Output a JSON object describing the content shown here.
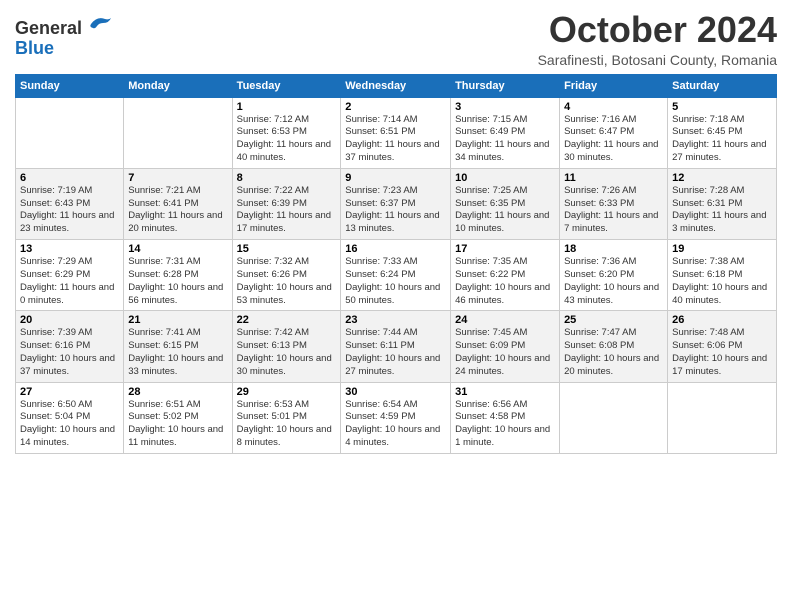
{
  "header": {
    "logo_general": "General",
    "logo_blue": "Blue",
    "main_title": "October 2024",
    "subtitle": "Sarafinesti, Botosani County, Romania"
  },
  "days_of_week": [
    "Sunday",
    "Monday",
    "Tuesday",
    "Wednesday",
    "Thursday",
    "Friday",
    "Saturday"
  ],
  "weeks": [
    [
      {
        "day": "",
        "info": ""
      },
      {
        "day": "",
        "info": ""
      },
      {
        "day": "1",
        "info": "Sunrise: 7:12 AM\nSunset: 6:53 PM\nDaylight: 11 hours and 40 minutes."
      },
      {
        "day": "2",
        "info": "Sunrise: 7:14 AM\nSunset: 6:51 PM\nDaylight: 11 hours and 37 minutes."
      },
      {
        "day": "3",
        "info": "Sunrise: 7:15 AM\nSunset: 6:49 PM\nDaylight: 11 hours and 34 minutes."
      },
      {
        "day": "4",
        "info": "Sunrise: 7:16 AM\nSunset: 6:47 PM\nDaylight: 11 hours and 30 minutes."
      },
      {
        "day": "5",
        "info": "Sunrise: 7:18 AM\nSunset: 6:45 PM\nDaylight: 11 hours and 27 minutes."
      }
    ],
    [
      {
        "day": "6",
        "info": "Sunrise: 7:19 AM\nSunset: 6:43 PM\nDaylight: 11 hours and 23 minutes."
      },
      {
        "day": "7",
        "info": "Sunrise: 7:21 AM\nSunset: 6:41 PM\nDaylight: 11 hours and 20 minutes."
      },
      {
        "day": "8",
        "info": "Sunrise: 7:22 AM\nSunset: 6:39 PM\nDaylight: 11 hours and 17 minutes."
      },
      {
        "day": "9",
        "info": "Sunrise: 7:23 AM\nSunset: 6:37 PM\nDaylight: 11 hours and 13 minutes."
      },
      {
        "day": "10",
        "info": "Sunrise: 7:25 AM\nSunset: 6:35 PM\nDaylight: 11 hours and 10 minutes."
      },
      {
        "day": "11",
        "info": "Sunrise: 7:26 AM\nSunset: 6:33 PM\nDaylight: 11 hours and 7 minutes."
      },
      {
        "day": "12",
        "info": "Sunrise: 7:28 AM\nSunset: 6:31 PM\nDaylight: 11 hours and 3 minutes."
      }
    ],
    [
      {
        "day": "13",
        "info": "Sunrise: 7:29 AM\nSunset: 6:29 PM\nDaylight: 11 hours and 0 minutes."
      },
      {
        "day": "14",
        "info": "Sunrise: 7:31 AM\nSunset: 6:28 PM\nDaylight: 10 hours and 56 minutes."
      },
      {
        "day": "15",
        "info": "Sunrise: 7:32 AM\nSunset: 6:26 PM\nDaylight: 10 hours and 53 minutes."
      },
      {
        "day": "16",
        "info": "Sunrise: 7:33 AM\nSunset: 6:24 PM\nDaylight: 10 hours and 50 minutes."
      },
      {
        "day": "17",
        "info": "Sunrise: 7:35 AM\nSunset: 6:22 PM\nDaylight: 10 hours and 46 minutes."
      },
      {
        "day": "18",
        "info": "Sunrise: 7:36 AM\nSunset: 6:20 PM\nDaylight: 10 hours and 43 minutes."
      },
      {
        "day": "19",
        "info": "Sunrise: 7:38 AM\nSunset: 6:18 PM\nDaylight: 10 hours and 40 minutes."
      }
    ],
    [
      {
        "day": "20",
        "info": "Sunrise: 7:39 AM\nSunset: 6:16 PM\nDaylight: 10 hours and 37 minutes."
      },
      {
        "day": "21",
        "info": "Sunrise: 7:41 AM\nSunset: 6:15 PM\nDaylight: 10 hours and 33 minutes."
      },
      {
        "day": "22",
        "info": "Sunrise: 7:42 AM\nSunset: 6:13 PM\nDaylight: 10 hours and 30 minutes."
      },
      {
        "day": "23",
        "info": "Sunrise: 7:44 AM\nSunset: 6:11 PM\nDaylight: 10 hours and 27 minutes."
      },
      {
        "day": "24",
        "info": "Sunrise: 7:45 AM\nSunset: 6:09 PM\nDaylight: 10 hours and 24 minutes."
      },
      {
        "day": "25",
        "info": "Sunrise: 7:47 AM\nSunset: 6:08 PM\nDaylight: 10 hours and 20 minutes."
      },
      {
        "day": "26",
        "info": "Sunrise: 7:48 AM\nSunset: 6:06 PM\nDaylight: 10 hours and 17 minutes."
      }
    ],
    [
      {
        "day": "27",
        "info": "Sunrise: 6:50 AM\nSunset: 5:04 PM\nDaylight: 10 hours and 14 minutes."
      },
      {
        "day": "28",
        "info": "Sunrise: 6:51 AM\nSunset: 5:02 PM\nDaylight: 10 hours and 11 minutes."
      },
      {
        "day": "29",
        "info": "Sunrise: 6:53 AM\nSunset: 5:01 PM\nDaylight: 10 hours and 8 minutes."
      },
      {
        "day": "30",
        "info": "Sunrise: 6:54 AM\nSunset: 4:59 PM\nDaylight: 10 hours and 4 minutes."
      },
      {
        "day": "31",
        "info": "Sunrise: 6:56 AM\nSunset: 4:58 PM\nDaylight: 10 hours and 1 minute."
      },
      {
        "day": "",
        "info": ""
      },
      {
        "day": "",
        "info": ""
      }
    ]
  ]
}
